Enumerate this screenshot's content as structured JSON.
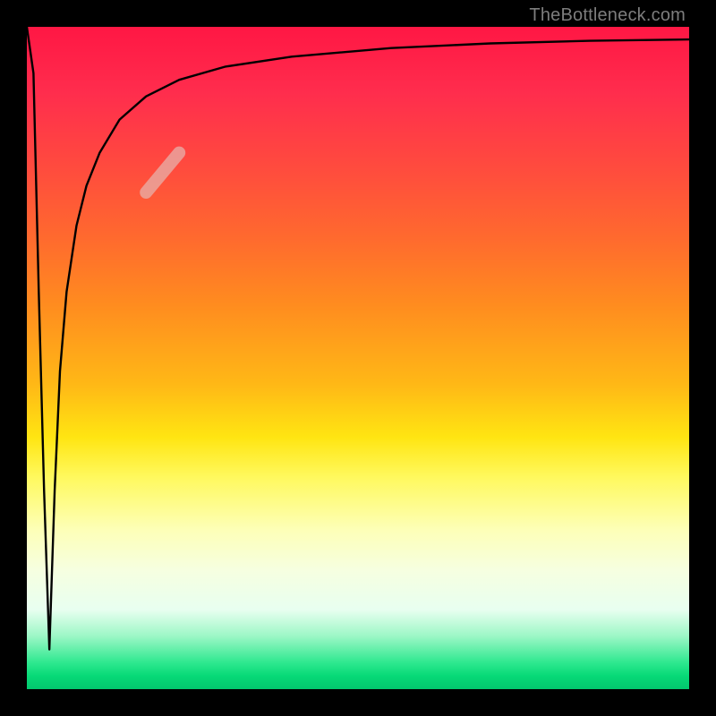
{
  "watermark": "TheBottleneck.com",
  "colors": {
    "frame": "#000000",
    "curve": "#000000",
    "highlight": "rgba(230,180,175,0.72)"
  },
  "chart_data": {
    "type": "line",
    "title": "",
    "xlabel": "",
    "ylabel": "",
    "xlim": [
      0,
      100
    ],
    "ylim": [
      0,
      100
    ],
    "grid": false,
    "legend": false,
    "series": [
      {
        "name": "bottleneck-curve",
        "x": [
          0.0,
          1.0,
          1.8,
          2.6,
          3.4,
          4.2,
          5.0,
          6.0,
          7.5,
          9.0,
          11.0,
          14.0,
          18.0,
          23.0,
          30.0,
          40.0,
          55.0,
          70.0,
          85.0,
          100.0
        ],
        "y": [
          100.0,
          93.0,
          60.0,
          30.0,
          6.0,
          30.0,
          48.0,
          60.0,
          70.0,
          76.0,
          81.0,
          86.0,
          89.5,
          92.0,
          94.0,
          95.5,
          96.8,
          97.5,
          97.9,
          98.1
        ]
      }
    ],
    "highlight_segment": {
      "x": [
        18.0,
        23.0
      ],
      "y": [
        75.0,
        81.0
      ]
    }
  }
}
